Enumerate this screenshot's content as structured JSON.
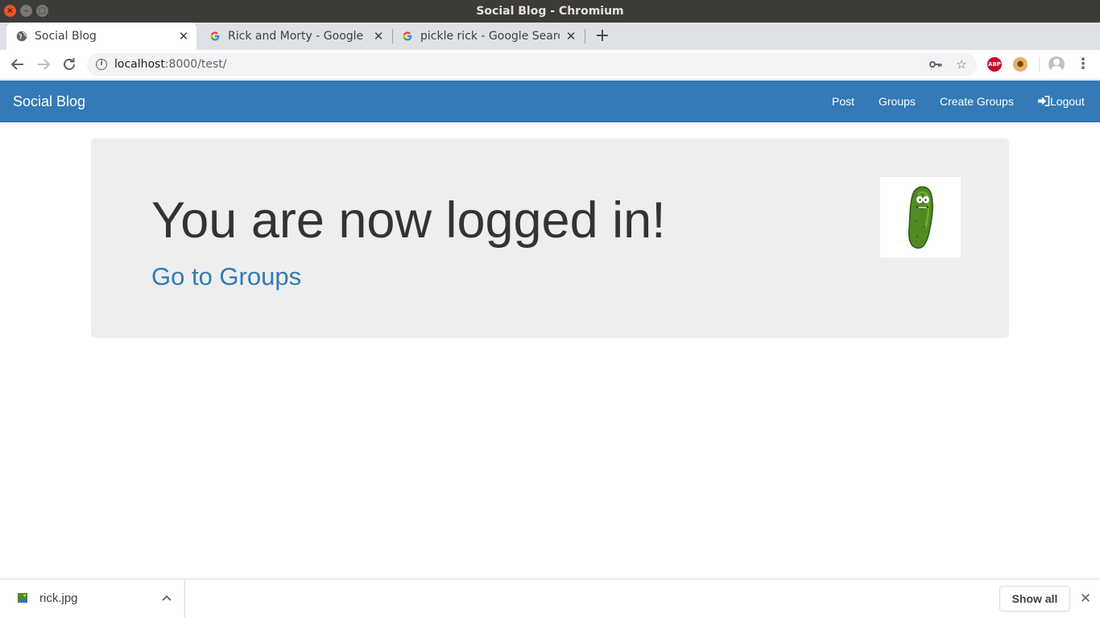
{
  "window": {
    "title": "Social Blog - Chromium"
  },
  "tabs": [
    {
      "label": "Social Blog",
      "active": true
    },
    {
      "label": "Rick and Morty - Google Search",
      "active": false
    },
    {
      "label": "pickle rick - Google Search",
      "active": false
    }
  ],
  "toolbar": {
    "url_host": "localhost",
    "url_rest": ":8000/test/",
    "ext_abp_label": "ABP"
  },
  "site": {
    "brand": "Social Blog",
    "nav": {
      "post": "Post",
      "groups": "Groups",
      "create_groups": "Create Groups",
      "logout": "Logout"
    }
  },
  "main": {
    "heading": "You are now logged in!",
    "link": "Go to Groups"
  },
  "downloads": {
    "file_name": "rick.jpg",
    "show_all": "Show all"
  },
  "colors": {
    "navbar": "#337ab7",
    "link": "#337ab7",
    "jumbotron": "#eeeeee"
  }
}
